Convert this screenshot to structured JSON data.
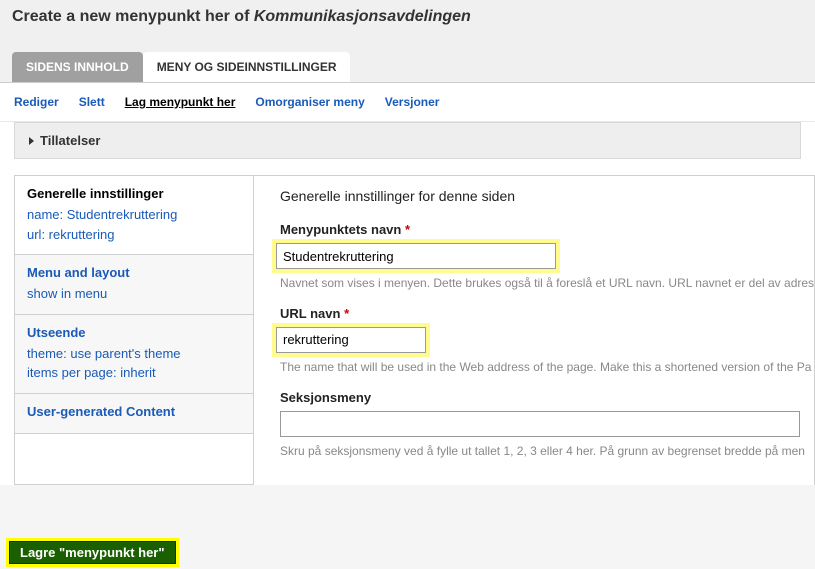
{
  "header": {
    "prefix": "Create a new menypunkt her of ",
    "dept": "Kommunikasjonsavdelingen"
  },
  "tabs": {
    "content": "SIDENS INNHOLD",
    "settings": "MENY OG SIDEINNSTILLINGER"
  },
  "subnav": {
    "edit": "Rediger",
    "delete": "Slett",
    "current": "Lag menypunkt her",
    "reorg": "Omorganiser meny",
    "versions": "Versjoner"
  },
  "permissions": "Tillatelser",
  "sidebar": {
    "general": {
      "title": "Generelle innstillinger",
      "name_line": "name: Studentrekruttering",
      "url_line": "url: rekruttering"
    },
    "menu": {
      "title": "Menu and layout",
      "line": "show in menu"
    },
    "appearance": {
      "title": "Utseende",
      "theme_line": "theme: use parent's theme",
      "items_line": "items per page: inherit"
    },
    "ugc": {
      "title": "User-generated Content"
    }
  },
  "form": {
    "heading": "Generelle innstillinger for denne siden",
    "menuname": {
      "label": "Menypunktets navn",
      "value": "Studentrekruttering",
      "help": "Navnet som vises i menyen. Dette brukes også til å foreslå et URL navn. URL navnet er del av adressen, som i www.nmbu.no/forskning/disputaser"
    },
    "urlname": {
      "label": "URL navn",
      "value": "rekruttering",
      "help": "The name that will be used in the Web address of the page. Make this a shortened version of the Pa"
    },
    "section": {
      "label": "Seksjonsmeny",
      "value": "",
      "help": "Skru på seksjonsmeny ved å fylle ut tallet 1, 2, 3 eller 4 her. På grunn av begrenset bredde på men"
    }
  },
  "save_button": "Lagre \"menypunkt her\""
}
